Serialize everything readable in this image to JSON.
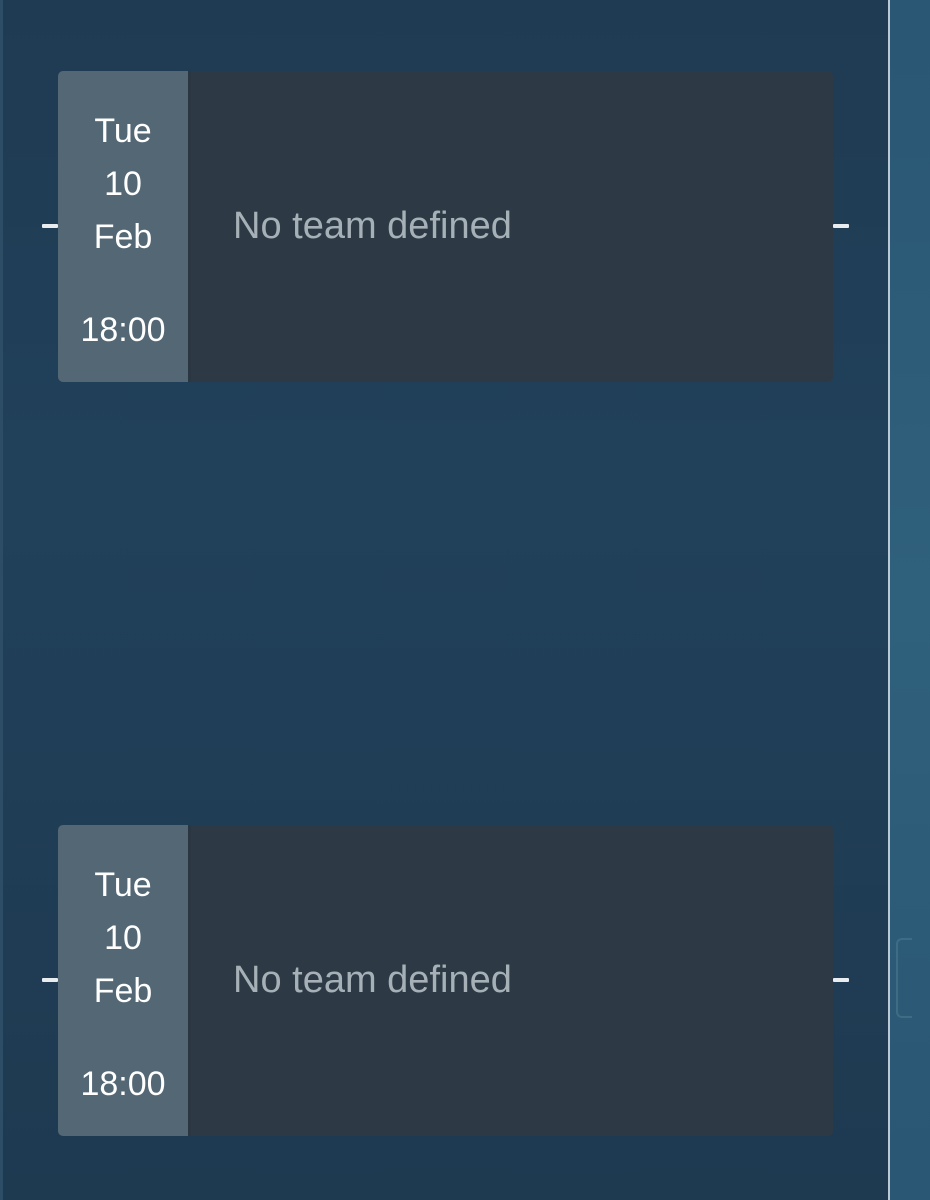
{
  "matches": [
    {
      "day": "Tue",
      "date": "10",
      "month": "Feb",
      "time": "18:00",
      "team_text": "No team defined"
    },
    {
      "day": "Tue",
      "date": "10",
      "month": "Feb",
      "time": "18:00",
      "team_text": "No team defined"
    }
  ]
}
